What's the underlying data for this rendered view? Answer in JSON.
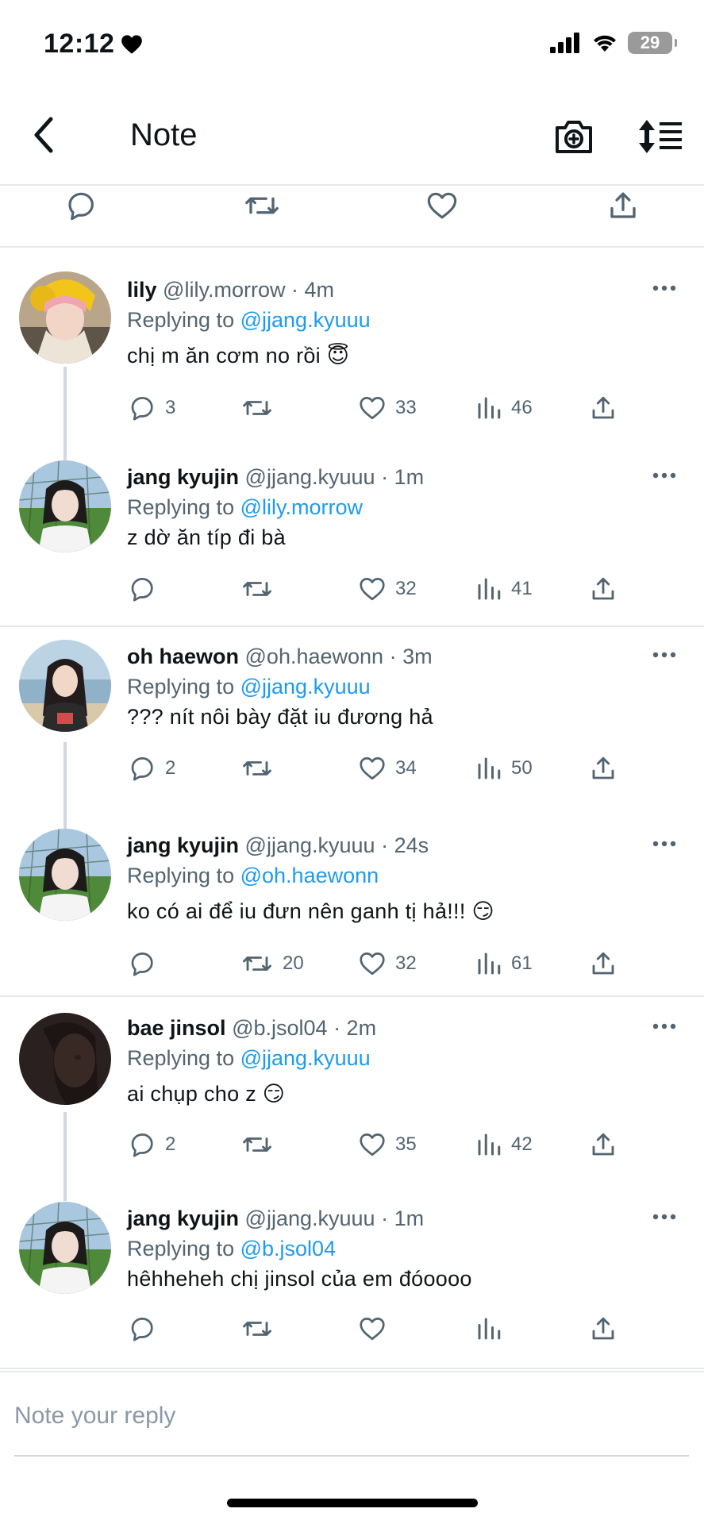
{
  "status_bar": {
    "time": "12:12",
    "battery": "29"
  },
  "header": {
    "title": "Note"
  },
  "replies": [
    {
      "name": "lily",
      "handle": "@lily.morrow",
      "time": "· 4m",
      "replying_label": "Replying to",
      "replying_to": "@jjang.kyuuu",
      "text": "chị m ăn cơm no rồi 😇",
      "reply_count": "3",
      "retweet_count": "",
      "like_count": "33",
      "view_count": "46"
    },
    {
      "name": "jang kyujin",
      "handle": "@jjang.kyuuu",
      "time": "· 1m",
      "replying_label": "Replying to",
      "replying_to": "@lily.morrow",
      "text": "z dờ ăn típ đi bà",
      "reply_count": "",
      "retweet_count": "",
      "like_count": "32",
      "view_count": "41"
    },
    {
      "name": "oh haewon",
      "handle": "@oh.haewonn",
      "time": "· 3m",
      "replying_label": "Replying to",
      "replying_to": "@jjang.kyuuu",
      "text": "??? nít nôi bày đặt iu đương hả",
      "reply_count": "2",
      "retweet_count": "",
      "like_count": "34",
      "view_count": "50"
    },
    {
      "name": "jang kyujin",
      "handle": "@jjang.kyuuu",
      "time": "· 24s",
      "replying_label": "Replying to",
      "replying_to": "@oh.haewonn",
      "text": "ko có ai để iu đưn nên ganh tị hả!!! 😏",
      "reply_count": "",
      "retweet_count": "20",
      "like_count": "32",
      "view_count": "61"
    },
    {
      "name": "bae jinsol",
      "handle": "@b.jsol04",
      "time": "· 2m",
      "replying_label": "Replying to",
      "replying_to": "@jjang.kyuuu",
      "text": "ai chụp cho z 😏",
      "reply_count": "2",
      "retweet_count": "",
      "like_count": "35",
      "view_count": "42"
    },
    {
      "name": "jang kyujin",
      "handle": "@jjang.kyuuu",
      "time": "· 1m",
      "replying_label": "Replying to",
      "replying_to": "@b.jsol04",
      "text": "hêhheheh chị jinsol của em đóoooo",
      "reply_count": "",
      "retweet_count": "",
      "like_count": "",
      "view_count": ""
    }
  ],
  "composer": {
    "placeholder": "Note your reply"
  },
  "icons": {
    "back": "chevron-left-icon",
    "camera": "camera-plus-icon",
    "sort": "sort-list-icon",
    "reply": "speech-bubble-icon",
    "retweet": "retweet-icon",
    "like": "heart-icon",
    "views": "bar-chart-icon",
    "share": "share-icon",
    "more": "more-dots-icon"
  },
  "colors": {
    "accent": "#1d9bf0",
    "secondary_text": "#536471",
    "divider": "#e6e9ec"
  }
}
